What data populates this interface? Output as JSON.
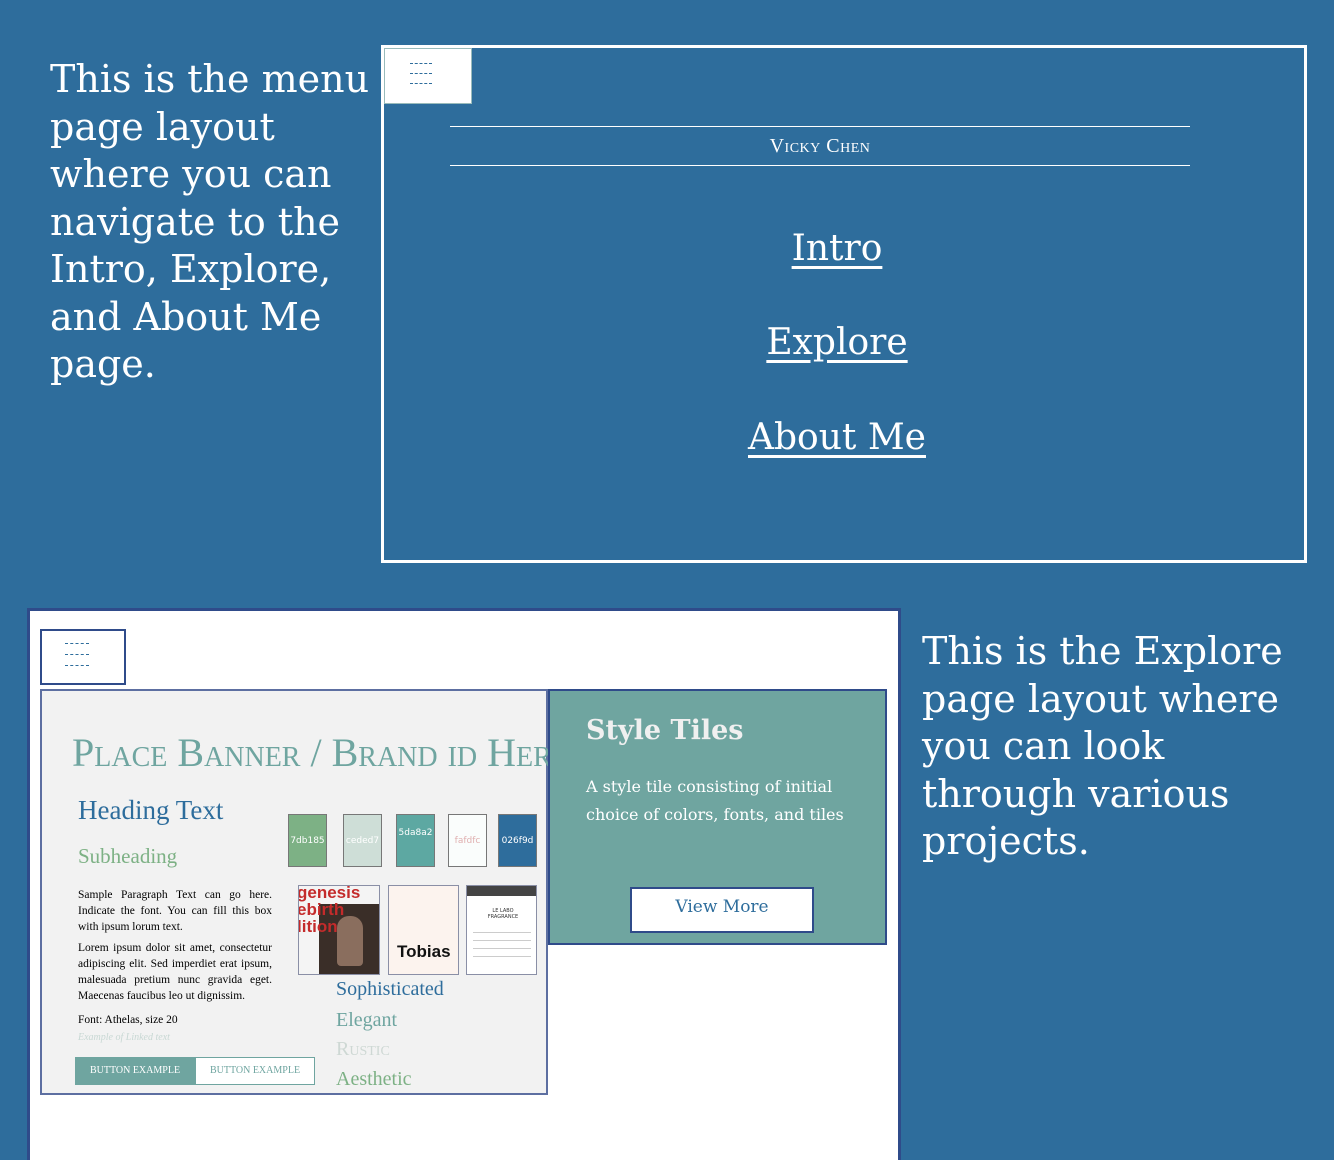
{
  "captions": {
    "menu": "This is the menu page layout where you can navigate to the Intro, Explore, and About Me page.",
    "explore": "This is the Explore page layout where you can look through various projects."
  },
  "menu_mockup": {
    "name": "Vicky Chen",
    "links": [
      "Intro",
      "Explore",
      "About Me"
    ]
  },
  "explore_mockup": {
    "style_tile": {
      "banner": "Place Banner / Brand id Here",
      "heading": "Heading Text",
      "subheading": "Subheading",
      "paragraph_1": "Sample Paragraph Text can go here. Indicate the font. You can fill this box with ipsum lorum text.",
      "paragraph_2": "Lorem ipsum dolor sit amet, consectetur adipiscing elit. Sed imperdiet erat ipsum, malesuada pretium nunc gravida eget. Maecenas faucibus leo ut dignissim.",
      "font_label": "Font: Athelas, size 20",
      "linked_text": "Example of Linked text",
      "button_1": "BUTTON EXAMPLE",
      "button_2": "BUTTON EXAMPLE",
      "swatches": [
        {
          "label": "7db185",
          "color": "#7db185"
        },
        {
          "label": "ceded7",
          "color": "#ceded7"
        },
        {
          "label": "5da8a2",
          "color": "#5da8a2"
        },
        {
          "label": "fafdfc",
          "color": "#fafdfc"
        },
        {
          "label": "026f9d",
          "color": "#2e6d9c"
        }
      ],
      "thumbnails": {
        "genesis": "genesis ebirth lition",
        "tobias": "Tobias",
        "lelabo": "LE LABO FRAGRANCE"
      },
      "moods": [
        "Sophisticated",
        "Elegant",
        "Rustic",
        "Aesthetic"
      ]
    },
    "card": {
      "title": "Style Tiles",
      "description": "A style tile consisting of initial choice of colors, fonts, and tiles",
      "button": "View More"
    }
  },
  "colors": {
    "background": "#2e6d9c",
    "accent_teal": "#6fa5a0",
    "accent_green": "#7db185",
    "border_navy": "#2f4b8a"
  }
}
